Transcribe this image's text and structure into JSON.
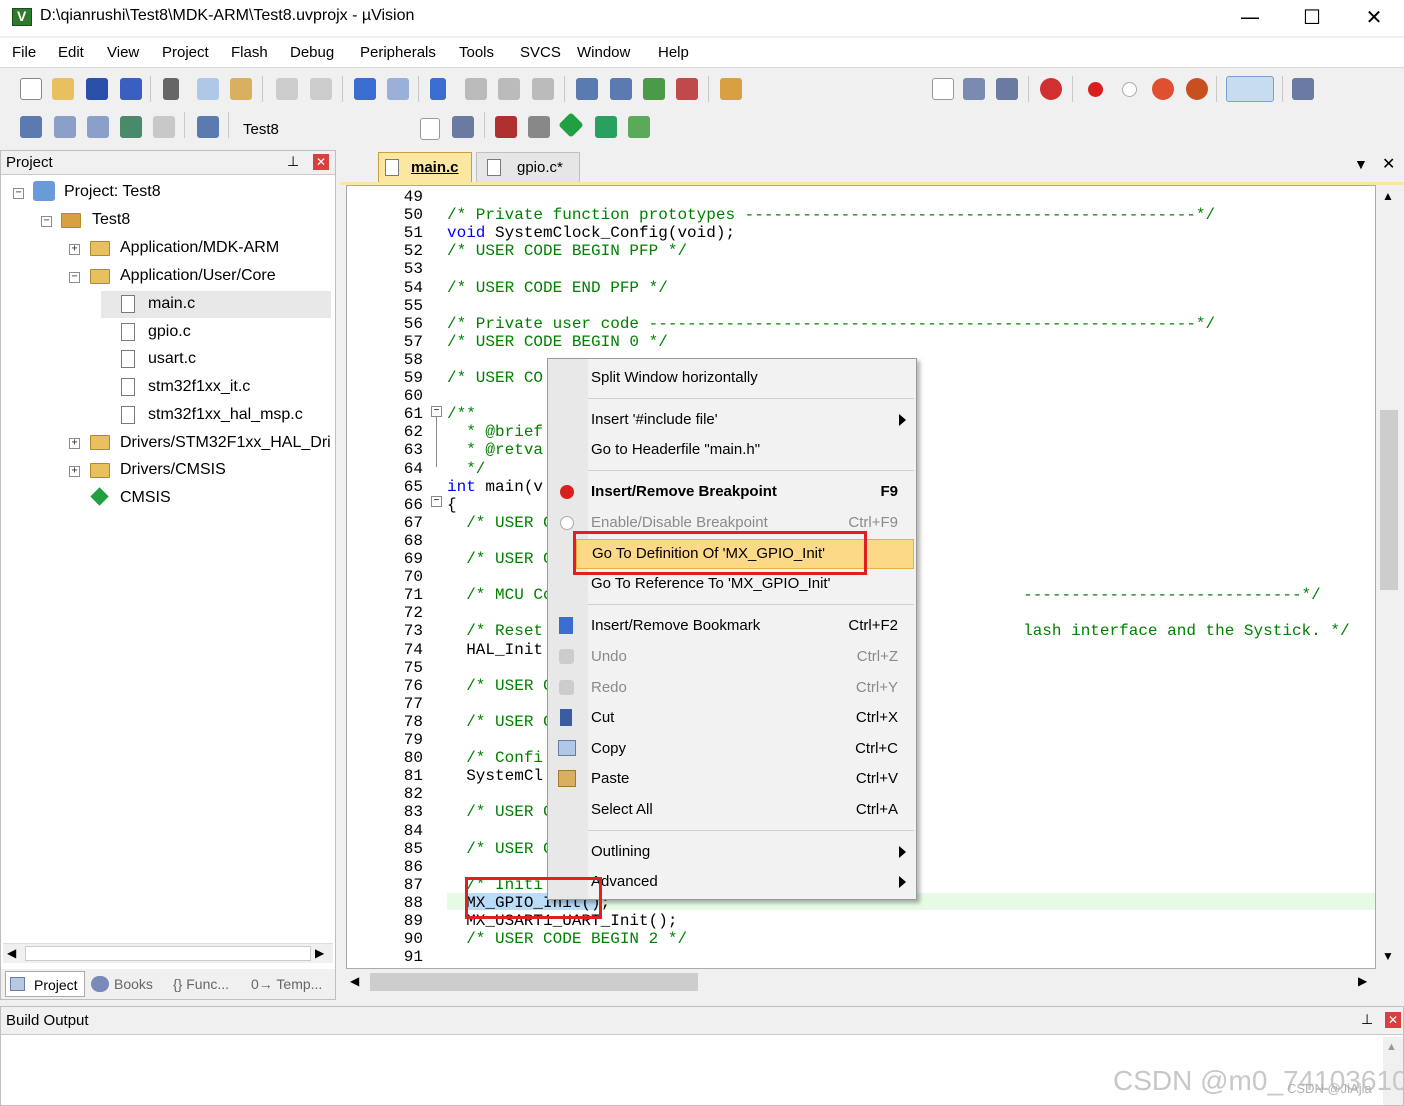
{
  "window": {
    "title": "D:\\qianrushi\\Test8\\MDK-ARM\\Test8.uvprojx - µVision",
    "controls": {
      "minimize": "—",
      "maximize": "☐",
      "close": "✕"
    }
  },
  "menubar": [
    "File",
    "Edit",
    "View",
    "Project",
    "Flash",
    "Debug",
    "Peripherals",
    "Tools",
    "SVCS",
    "Window",
    "Help"
  ],
  "toolbar2": {
    "target": "Test8"
  },
  "project_panel": {
    "title": "Project",
    "tree": [
      {
        "label": "Project: Test8"
      },
      {
        "label": "Test8"
      },
      {
        "label": "Application/MDK-ARM"
      },
      {
        "label": "Application/User/Core"
      },
      {
        "label": "main.c"
      },
      {
        "label": "gpio.c"
      },
      {
        "label": "usart.c"
      },
      {
        "label": "stm32f1xx_it.c"
      },
      {
        "label": "stm32f1xx_hal_msp.c"
      },
      {
        "label": "Drivers/STM32F1xx_HAL_Dri"
      },
      {
        "label": "Drivers/CMSIS"
      },
      {
        "label": "CMSIS"
      }
    ],
    "bottom_tabs": [
      "Project",
      "Books",
      "{} Func...",
      "0→ Temp..."
    ]
  },
  "editor": {
    "tabs": [
      {
        "label": "main.c",
        "active": true
      },
      {
        "label": "gpio.c*",
        "active": false
      }
    ],
    "lines": [
      {
        "n": "49",
        "text": ""
      },
      {
        "n": "50",
        "text": "/* Private function prototypes -----------------------------------------------*/"
      },
      {
        "n": "51",
        "text": "void SystemClock_Config(void);"
      },
      {
        "n": "52",
        "text": "/* USER CODE BEGIN PFP */"
      },
      {
        "n": "53",
        "text": ""
      },
      {
        "n": "54",
        "text": "/* USER CODE END PFP */"
      },
      {
        "n": "55",
        "text": ""
      },
      {
        "n": "56",
        "text": "/* Private user code ---------------------------------------------------------*/"
      },
      {
        "n": "57",
        "text": "/* USER CODE BEGIN 0 */"
      },
      {
        "n": "58",
        "text": ""
      },
      {
        "n": "59",
        "text": "/* USER CO"
      },
      {
        "n": "60",
        "text": ""
      },
      {
        "n": "61",
        "text": "/**"
      },
      {
        "n": "62",
        "text": "  * @brief"
      },
      {
        "n": "63",
        "text": "  * @retva"
      },
      {
        "n": "64",
        "text": "  */"
      },
      {
        "n": "65",
        "text": "int main(v"
      },
      {
        "n": "66",
        "text": "{"
      },
      {
        "n": "67",
        "text": "  /* USER C"
      },
      {
        "n": "68",
        "text": ""
      },
      {
        "n": "69",
        "text": "  /* USER C"
      },
      {
        "n": "70",
        "text": ""
      },
      {
        "n": "71",
        "text": "  /* MCU Co                                                 -----------------------------*/"
      },
      {
        "n": "72",
        "text": ""
      },
      {
        "n": "73",
        "text": "  /* Reset                                                  lash interface and the Systick. */"
      },
      {
        "n": "74",
        "text": "  HAL_Init"
      },
      {
        "n": "75",
        "text": ""
      },
      {
        "n": "76",
        "text": "  /* USER C"
      },
      {
        "n": "77",
        "text": ""
      },
      {
        "n": "78",
        "text": "  /* USER C"
      },
      {
        "n": "79",
        "text": ""
      },
      {
        "n": "80",
        "text": "  /* Confi"
      },
      {
        "n": "81",
        "text": "  SystemCl"
      },
      {
        "n": "82",
        "text": ""
      },
      {
        "n": "83",
        "text": "  /* USER C"
      },
      {
        "n": "84",
        "text": ""
      },
      {
        "n": "85",
        "text": "  /* USER C"
      },
      {
        "n": "86",
        "text": ""
      },
      {
        "n": "87",
        "text": "  /* Initi"
      },
      {
        "n": "88",
        "text": "  MX_GPIO_Init();"
      },
      {
        "n": "89",
        "text": "  MX_USART1_UART_Init();"
      },
      {
        "n": "90",
        "text": "  /* USER CODE BEGIN 2 */"
      },
      {
        "n": "91",
        "text": ""
      }
    ]
  },
  "context_menu": {
    "items": [
      {
        "label": "Split Window horizontally",
        "shortcut": ""
      },
      {
        "label": "Insert '#include file'",
        "shortcut": "",
        "submenu": true
      },
      {
        "label": "Go to Headerfile \"main.h\"",
        "shortcut": ""
      },
      {
        "label": "Insert/Remove Breakpoint",
        "shortcut": "F9"
      },
      {
        "label": "Enable/Disable Breakpoint",
        "shortcut": "Ctrl+F9",
        "disabled": true
      },
      {
        "label": "Go To Definition Of 'MX_GPIO_Init'",
        "shortcut": "",
        "highlighted": true
      },
      {
        "label": "Go To Reference To 'MX_GPIO_Init'",
        "shortcut": ""
      },
      {
        "label": "Insert/Remove Bookmark",
        "shortcut": "Ctrl+F2"
      },
      {
        "label": "Undo",
        "shortcut": "Ctrl+Z",
        "disabled": true
      },
      {
        "label": "Redo",
        "shortcut": "Ctrl+Y",
        "disabled": true
      },
      {
        "label": "Cut",
        "shortcut": "Ctrl+X"
      },
      {
        "label": "Copy",
        "shortcut": "Ctrl+C"
      },
      {
        "label": "Paste",
        "shortcut": "Ctrl+V"
      },
      {
        "label": "Select All",
        "shortcut": "Ctrl+A"
      },
      {
        "label": "Outlining",
        "shortcut": "",
        "submenu": true
      },
      {
        "label": "Advanced",
        "shortcut": "",
        "submenu": true
      }
    ]
  },
  "build_output": {
    "title": "Build Output"
  },
  "watermark": {
    "text": "CSDN @m0_74103610",
    "small": "CSDN @JiAjia"
  },
  "colors": {
    "comment": "#008000",
    "keyword": "#0000ff",
    "highlight": "#fbd986",
    "annotation_box": "#e02020"
  }
}
